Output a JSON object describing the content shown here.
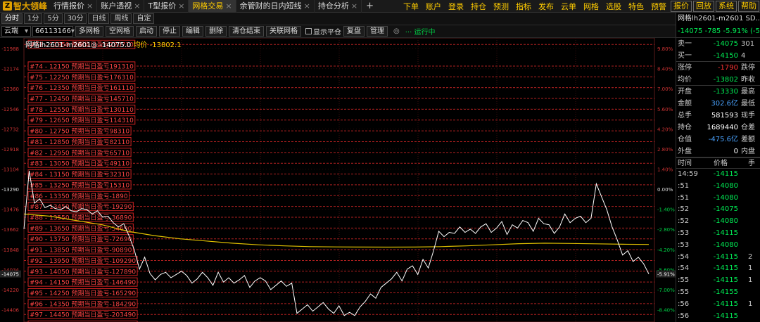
{
  "app": {
    "logo_text": "智大领峰",
    "tabs": [
      {
        "label": "行情报价",
        "active": false
      },
      {
        "label": "账户透视",
        "active": false
      },
      {
        "label": "T型报价",
        "active": false
      },
      {
        "label": "网格交易",
        "active": true
      },
      {
        "label": "余管财的日内短线",
        "active": false
      },
      {
        "label": "持仓分析",
        "active": false
      }
    ],
    "plus": "+",
    "menu": [
      "下单",
      "账户",
      "登录",
      "持仓",
      "预测",
      "指标",
      "发布",
      "云单",
      "网格",
      "选股",
      "特色",
      "预警"
    ],
    "menu_boxed": [
      "报价",
      "回放",
      "系统",
      "帮助"
    ]
  },
  "periods": [
    "分时",
    "1分",
    "5分",
    "30分",
    "日线",
    "周线",
    "自定"
  ],
  "toolbar": {
    "source": "云端",
    "account": "66113166",
    "buttons": [
      "多网格",
      "空网格",
      "启动",
      "停止",
      "编辑",
      "删除",
      "清仓结束",
      "关联网格"
    ],
    "checkbox_label": "显示平仓",
    "buttons2": [
      "复盘",
      "管理"
    ],
    "status": "运行中"
  },
  "chart_info": {
    "title": "网格lh2601-m2601◎",
    "last": "-14075.0",
    "avg_label": "均价",
    "avg_value": "-13802.1"
  },
  "chart_data": {
    "type": "line",
    "y_range": [
      -14520,
      -11890
    ],
    "x_points": 120,
    "left_ticks": [
      "-11988",
      "-12174",
      "-12360",
      "-12546",
      "-12732",
      "-12918",
      "-13104",
      "-13290",
      "-13476",
      "-13662",
      "-13848",
      "-14034",
      "-14220",
      "-14406"
    ],
    "left_tick_values": [
      -11988,
      -12174,
      -12360,
      -12546,
      -12732,
      -12918,
      -13104,
      -13290,
      -13476,
      -13662,
      -13848,
      -14034,
      -14220,
      -14406
    ],
    "right_ticks": [
      "9.80%",
      "8.40%",
      "7.00%",
      "5.60%",
      "4.20%",
      "2.80%",
      "1.40%",
      "0.00%",
      "-1.40%",
      "-2.80%",
      "-4.20%",
      "-5.60%",
      "-7.00%",
      "-8.40%"
    ],
    "current_left_label": "-14075",
    "current_right_label": "-5.91%",
    "current_value": -14075,
    "grid_levels": [
      {
        "label": "#72 - 11950 预期当日盈亏220710",
        "value": -11950
      },
      {
        "label": "#74 - 12150 预期当日盈亏191310",
        "value": -12150
      },
      {
        "label": "#75 - 12250 预期当日盈亏176310",
        "value": -12250
      },
      {
        "label": "#76 - 12350 预期当日盈亏161110",
        "value": -12350
      },
      {
        "label": "#77 - 12450 预期当日盈亏145710",
        "value": -12450
      },
      {
        "label": "#78 - 12550 预期当日盈亏130110",
        "value": -12550
      },
      {
        "label": "#79 - 12650 预期当日盈亏114310",
        "value": -12650
      },
      {
        "label": "#80 - 12750 预期当日盈亏98310",
        "value": -12750
      },
      {
        "label": "#81 - 12850 预期当日盈亏82110",
        "value": -12850
      },
      {
        "label": "#82 - 12950 预期当日盈亏65710",
        "value": -12950
      },
      {
        "label": "#83 - 13050 预期当日盈亏49110",
        "value": -13050
      },
      {
        "label": "#84 - 13150 预期当日盈亏32310",
        "value": -13150
      },
      {
        "label": "#85 - 13250 预期当日盈亏15310",
        "value": -13250
      },
      {
        "label": "#86 - 13350 预期当日盈亏-1890",
        "value": -13350
      },
      {
        "label": "#87 - 13450 预期当日盈亏-19290",
        "value": -13450
      },
      {
        "label": "#88 - 13550 预期当日盈亏-36890",
        "value": -13550
      },
      {
        "label": "#89 - 13650 预期当日盈亏-54690",
        "value": -13650
      },
      {
        "label": "#90 - 13750 预期当日盈亏-72690",
        "value": -13750
      },
      {
        "label": "#91 - 13850 预期当日盈亏-90890",
        "value": -13850
      },
      {
        "label": "#92 - 13950 预期当日盈亏-109290",
        "value": -13950
      },
      {
        "label": "#93 - 14050 预期当日盈亏-127890",
        "value": -14050
      },
      {
        "label": "#94 - 14150 预期当日盈亏-146490",
        "value": -14150
      },
      {
        "label": "#95 - 14250 预期当日盈亏-165290",
        "value": -14250
      },
      {
        "label": "#96 - 14350 预期当日盈亏-184290",
        "value": -14350
      },
      {
        "label": "#97 - 14450 预期当日盈亏-203490",
        "value": -14450
      },
      {
        "label": "#98 - 14550 预期当日盈亏-222890",
        "value": -14550
      }
    ],
    "price_series": [
      -13660,
      -13120,
      -13420,
      -13380,
      -13460,
      -13440,
      -13470,
      -13480,
      -13450,
      -13490,
      -13500,
      -13470,
      -13480,
      -13520,
      -13490,
      -13550,
      -13540,
      -13600,
      -13640,
      -13610,
      -13720,
      -13850,
      -14030,
      -13920,
      -14070,
      -14130,
      -14080,
      -14060,
      -14110,
      -14080,
      -14050,
      -14090,
      -14160,
      -14120,
      -14060,
      -14110,
      -14180,
      -14060,
      -14150,
      -14110,
      -14160,
      -14130,
      -14090,
      -14200,
      -14140,
      -14110,
      -14140,
      -14220,
      -14180,
      -14140,
      -14190,
      -14160,
      -14440,
      -14400,
      -14360,
      -14420,
      -14380,
      -14340,
      -14400,
      -14440,
      -14370,
      -14460,
      -14430,
      -14460,
      -14380,
      -14330,
      -14260,
      -14300,
      -14200,
      -14160,
      -14120,
      -14060,
      -14140,
      -14030,
      -14000,
      -14080,
      -13940,
      -14020,
      -13860,
      -13680,
      -13730,
      -13690,
      -13700,
      -13640,
      -13690,
      -13660,
      -13700,
      -13640,
      -13610,
      -13690,
      -13650,
      -13590,
      -13710,
      -13620,
      -13650,
      -13580,
      -13600,
      -13680,
      -13560,
      -13610,
      -13620,
      -13700,
      -13640,
      -13520,
      -13600,
      -13560,
      -13540,
      -13600,
      -13560,
      -13240,
      -13360,
      -13480,
      -13640,
      -13760,
      -13900,
      -13860,
      -13960,
      -13920,
      -13980,
      -14075
    ],
    "avg_series": [
      -13520,
      -13540,
      -13580,
      -13620,
      -13680,
      -13720,
      -13750,
      -13770,
      -13790,
      -13805,
      -13815,
      -13822,
      -13825,
      -13826,
      -13827,
      -13826,
      -13822,
      -13815,
      -13805,
      -13795,
      -13790,
      -13793,
      -13796,
      -13800,
      -13802
    ]
  },
  "right_panel": {
    "title": "网格lh2601-m2601 SD...",
    "quote": "-14075 -785 -5.91% (-5.9",
    "rows": [
      {
        "label": "卖一",
        "value": "-14075",
        "ext": "301",
        "cls": "g"
      },
      {
        "label": "买一",
        "value": "-14150",
        "ext": "4",
        "cls": "g"
      },
      {
        "label": "涨停",
        "value": "-1790",
        "ext": "跌停",
        "cls": "r"
      },
      {
        "label": "均价",
        "value": "-13802",
        "ext": "昨收",
        "cls": "g"
      },
      {
        "label": "开盘",
        "value": "-13330",
        "ext": "最高",
        "cls": "g"
      },
      {
        "label": "金额",
        "value": "302.6亿",
        "ext": "最低",
        "cls": "b"
      },
      {
        "label": "总手",
        "value": "581593",
        "ext": "现手",
        "cls": "w"
      },
      {
        "label": "持仓",
        "value": "1689440",
        "ext": "仓差",
        "cls": "w"
      },
      {
        "label": "仓值",
        "value": "-475.6亿",
        "ext": "差额",
        "cls": "b"
      },
      {
        "label": "外盘",
        "value": "0",
        "ext": "内盘",
        "cls": "w"
      }
    ],
    "ticks_header": [
      "时间",
      "价格",
      "手"
    ],
    "ticks": [
      {
        "t": "14:59",
        "p": "-14115",
        "v": ""
      },
      {
        "t": ":51",
        "p": "-14080",
        "v": ""
      },
      {
        "t": ":51",
        "p": "-14080",
        "v": ""
      },
      {
        "t": ":52",
        "p": "-14075",
        "v": ""
      },
      {
        "t": ":52",
        "p": "-14080",
        "v": ""
      },
      {
        "t": ":53",
        "p": "-14115",
        "v": ""
      },
      {
        "t": ":53",
        "p": "-14080",
        "v": ""
      },
      {
        "t": ":54",
        "p": "-14115",
        "v": "2"
      },
      {
        "t": ":54",
        "p": "-14115",
        "v": "1"
      },
      {
        "t": ":55",
        "p": "-14115",
        "v": "1"
      },
      {
        "t": ":55",
        "p": "-14155",
        "v": ""
      },
      {
        "t": ":56",
        "p": "-14115",
        "v": "1"
      },
      {
        "t": ":56",
        "p": "-14115",
        "v": ""
      }
    ]
  }
}
